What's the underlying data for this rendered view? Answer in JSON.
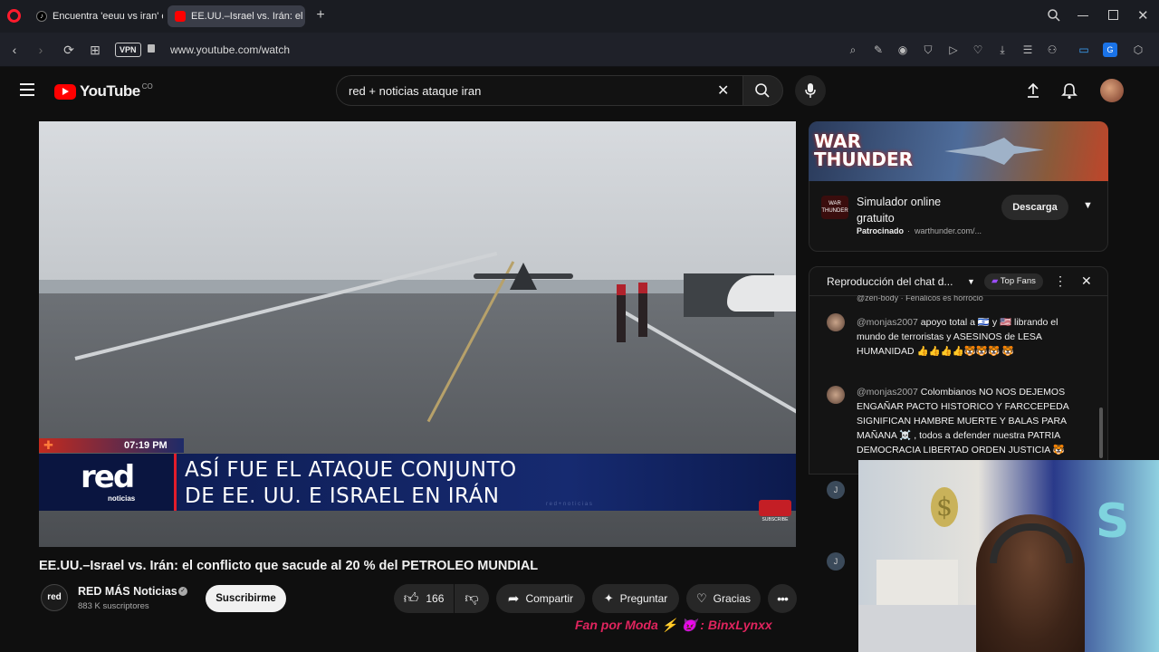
{
  "browser": {
    "tabs": [
      {
        "title": "Encuentra 'eeuu vs iran' en"
      },
      {
        "title": "EE.UU.–Israel vs. Irán: el co"
      }
    ],
    "vpn_label": "VPN",
    "url": "www.youtube.com/watch"
  },
  "youtube": {
    "logo_text": "YouTube",
    "country_code": "CO",
    "search_value": "red + noticias ataque iran"
  },
  "video": {
    "overlay_time": "07:19 PM",
    "channel_logo_top": "red",
    "channel_logo_sub": "noticias",
    "headline_line1": "ASÍ FUE EL ATAQUE CONJUNTO",
    "headline_line2": "DE EE. UU. E ISRAEL EN IRÁN",
    "ticker": "r e d + n o t i c i a s",
    "subscribe_mini": "SUBSCRIBE",
    "title": "EE.UU.–Israel vs. Irán: el conflicto que sacude al 20 % del PETROLEO MUNDIAL",
    "channel_name": "RED MÁS Noticias",
    "channel_avatar_text": "red",
    "subscribers": "883 K suscriptores",
    "subscribe_label": "Suscribirme",
    "likes": "166",
    "share_label": "Compartir",
    "ask_label": "Preguntar",
    "thanks_label": "Gracias"
  },
  "ad": {
    "banner_text": "WAR THUNDER",
    "logo_text": "WAR THUNDER",
    "title": "Simulador online gratuito",
    "sponsored": "Patrocinado",
    "domain": "warthunder.com/...",
    "cta": "Descarga"
  },
  "chat": {
    "header": "Reproducción del chat d...",
    "badge": "Top Fans",
    "partial_top": "@zen-body · Fenalicos es horrocio",
    "messages": [
      {
        "user": "@monjas2007",
        "text": "apoyo total a 🇮🇱 y 🇺🇸 librando el mundo de terroristas y ASESINOS de LESA HUMANIDAD 👍👍👍👍🐯🐯🐯 🐯"
      },
      {
        "user": "@monjas2007",
        "text": "Colombianos NO NOS DEJEMOS ENGAÑAR PACTO HISTORICO Y FARCCEPEDA SIGNIFICAN HAMBRE MUERTE Y BALAS PARA MAÑANA ☠️ , todos a defender nuestra PATRIA DEMOCRACIA LIBERTAD ORDEN JUSTICIA 🐯"
      }
    ],
    "avatar_initial": "J"
  },
  "streamer": {
    "overlay_text": "Fan por Moda ⚡ 👿 : BinxLynxx"
  },
  "colors": {
    "youtube_red": "#ff0000",
    "subscribe_bg": "#f1f1f1",
    "overlay_pink": "#e0245e",
    "news_banner": "#0b1a4a"
  }
}
